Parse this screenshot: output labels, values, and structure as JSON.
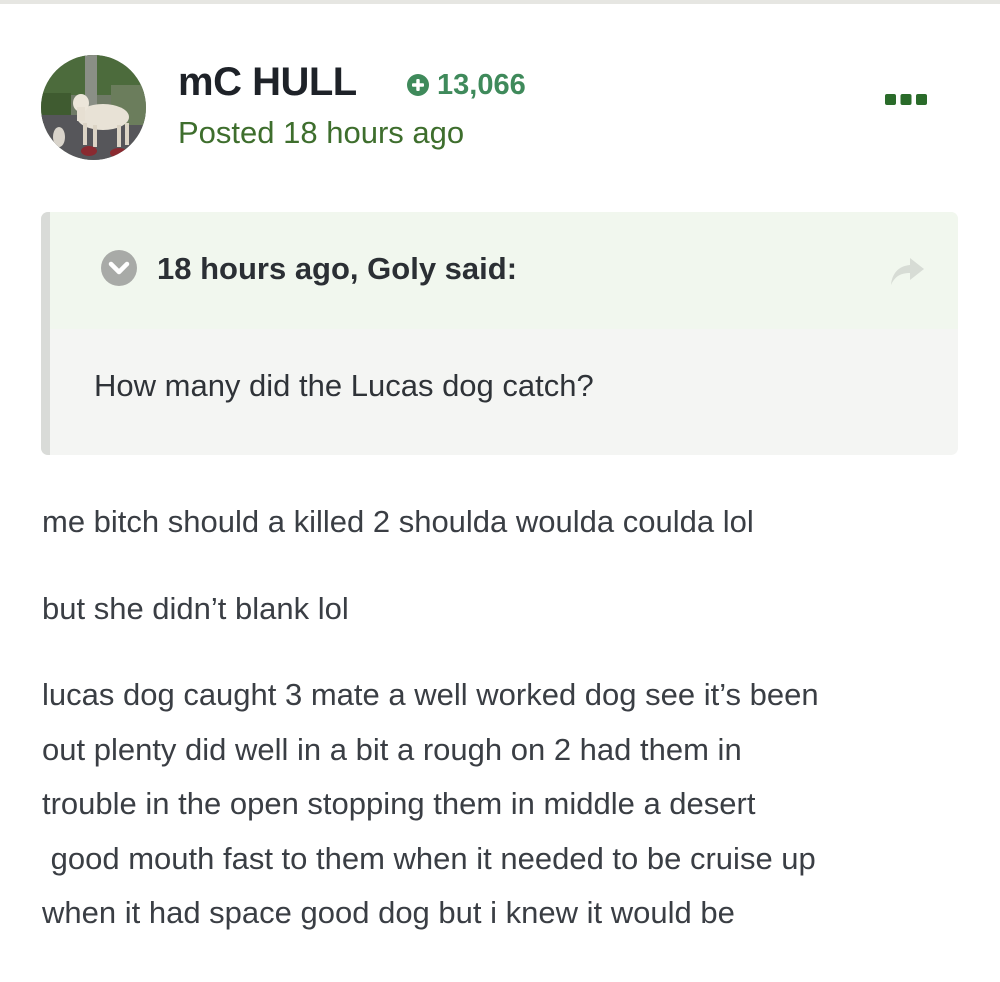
{
  "post": {
    "author": {
      "name": "mC HULL",
      "reputation": "13,066",
      "avatar_icon": "avatar-dog-photo"
    },
    "posted": "Posted 18 hours ago",
    "menu_icon": "more-options-icon",
    "quote": {
      "citation": "18 hours ago, Goly said:",
      "text": "How many did the Lucas dog catch?",
      "toggle_icon": "chevron-down-icon",
      "share_icon": "share-arrow-icon"
    },
    "body": {
      "paragraph_1": "me bitch should a killed 2 shoulda woulda coulda lol",
      "paragraph_2": "but she didn’t blank lol",
      "paragraph_3_lines": [
        "lucas dog caught 3 mate a well worked dog see it’s been",
        "out plenty did well in a bit a rough on 2 had them in",
        "trouble in the open stopping them in middle a desert",
        " good mouth fast to them when it needed to be cruise up",
        "when it had space good dog but i knew it would be"
      ]
    }
  },
  "colors": {
    "author_name": "#1e2228",
    "reputation": "#3f8a5b",
    "post_time": "#3e6e2d",
    "menu_dots": "#2a6b2a",
    "quote_background": "#f4f5f3",
    "quote_header_background": "#f1f7ee",
    "body_text": "#3a3e44"
  }
}
